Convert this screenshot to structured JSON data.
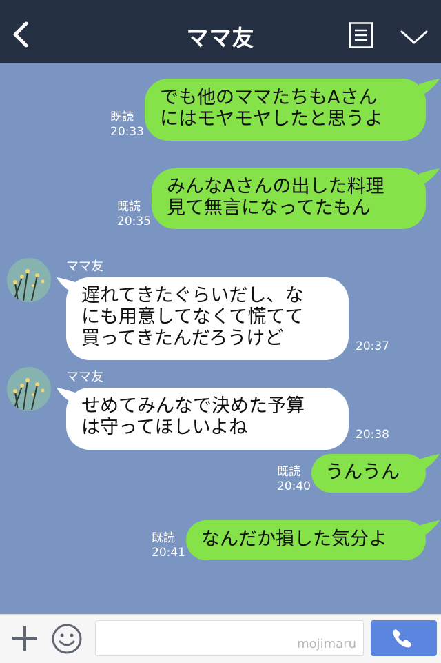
{
  "header": {
    "title": "ママ友",
    "icons": {
      "back": "chevron-left-icon",
      "menu": "list-menu-icon",
      "collapse": "chevron-down-icon"
    }
  },
  "colors": {
    "header_bg": "#253043",
    "chat_bg": "#7b95c2",
    "outgoing_bubble": "#85e249",
    "incoming_bubble": "#ffffff",
    "send_button": "#5a86e0"
  },
  "messages": [
    {
      "direction": "out",
      "lines": [
        "でも他のママたちもAさん",
        "にはモヤモヤしたと思うよ"
      ],
      "read": "既読",
      "time": "20:33"
    },
    {
      "direction": "out",
      "lines": [
        "みんなAさんの出した料理",
        "見て無言になってたもん"
      ],
      "read": "既読",
      "time": "20:35"
    },
    {
      "direction": "in",
      "sender": "ママ友",
      "lines": [
        "遅れてきたぐらいだし、な",
        "にも用意してなくて慌てて",
        "買ってきたんだろうけど"
      ],
      "time": "20:37"
    },
    {
      "direction": "in",
      "sender": "ママ友",
      "lines": [
        "せめてみんなで決めた予算",
        "は守ってほしいよね"
      ],
      "time": "20:38"
    },
    {
      "direction": "out",
      "lines": [
        "うんうん"
      ],
      "read": "既読",
      "time": "20:40"
    },
    {
      "direction": "out",
      "lines": [
        "なんだか損した気分よ"
      ],
      "read": "既読",
      "time": "20:41"
    }
  ],
  "input_bar": {
    "watermark": "mojimaru",
    "icons": {
      "add": "plus-icon",
      "sticker": "smiley-icon",
      "call": "phone-icon"
    }
  }
}
